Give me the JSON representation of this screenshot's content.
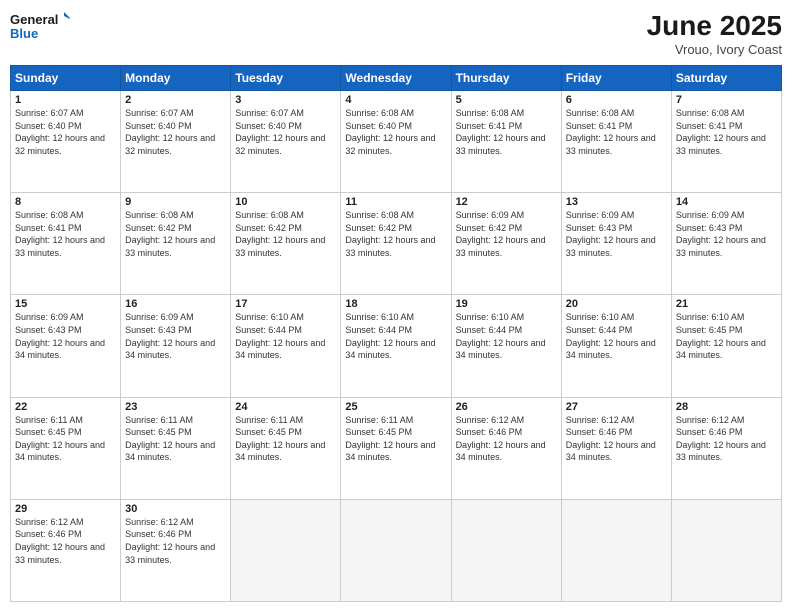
{
  "logo": {
    "line1": "General",
    "line2": "Blue"
  },
  "title": "June 2025",
  "location": "Vrouo, Ivory Coast",
  "days_of_week": [
    "Sunday",
    "Monday",
    "Tuesday",
    "Wednesday",
    "Thursday",
    "Friday",
    "Saturday"
  ],
  "weeks": [
    [
      {
        "day": "1",
        "sunrise": "6:07 AM",
        "sunset": "6:40 PM",
        "daylight": "12 hours and 32 minutes."
      },
      {
        "day": "2",
        "sunrise": "6:07 AM",
        "sunset": "6:40 PM",
        "daylight": "12 hours and 32 minutes."
      },
      {
        "day": "3",
        "sunrise": "6:07 AM",
        "sunset": "6:40 PM",
        "daylight": "12 hours and 32 minutes."
      },
      {
        "day": "4",
        "sunrise": "6:08 AM",
        "sunset": "6:40 PM",
        "daylight": "12 hours and 32 minutes."
      },
      {
        "day": "5",
        "sunrise": "6:08 AM",
        "sunset": "6:41 PM",
        "daylight": "12 hours and 33 minutes."
      },
      {
        "day": "6",
        "sunrise": "6:08 AM",
        "sunset": "6:41 PM",
        "daylight": "12 hours and 33 minutes."
      },
      {
        "day": "7",
        "sunrise": "6:08 AM",
        "sunset": "6:41 PM",
        "daylight": "12 hours and 33 minutes."
      }
    ],
    [
      {
        "day": "8",
        "sunrise": "6:08 AM",
        "sunset": "6:41 PM",
        "daylight": "12 hours and 33 minutes."
      },
      {
        "day": "9",
        "sunrise": "6:08 AM",
        "sunset": "6:42 PM",
        "daylight": "12 hours and 33 minutes."
      },
      {
        "day": "10",
        "sunrise": "6:08 AM",
        "sunset": "6:42 PM",
        "daylight": "12 hours and 33 minutes."
      },
      {
        "day": "11",
        "sunrise": "6:08 AM",
        "sunset": "6:42 PM",
        "daylight": "12 hours and 33 minutes."
      },
      {
        "day": "12",
        "sunrise": "6:09 AM",
        "sunset": "6:42 PM",
        "daylight": "12 hours and 33 minutes."
      },
      {
        "day": "13",
        "sunrise": "6:09 AM",
        "sunset": "6:43 PM",
        "daylight": "12 hours and 33 minutes."
      },
      {
        "day": "14",
        "sunrise": "6:09 AM",
        "sunset": "6:43 PM",
        "daylight": "12 hours and 33 minutes."
      }
    ],
    [
      {
        "day": "15",
        "sunrise": "6:09 AM",
        "sunset": "6:43 PM",
        "daylight": "12 hours and 34 minutes."
      },
      {
        "day": "16",
        "sunrise": "6:09 AM",
        "sunset": "6:43 PM",
        "daylight": "12 hours and 34 minutes."
      },
      {
        "day": "17",
        "sunrise": "6:10 AM",
        "sunset": "6:44 PM",
        "daylight": "12 hours and 34 minutes."
      },
      {
        "day": "18",
        "sunrise": "6:10 AM",
        "sunset": "6:44 PM",
        "daylight": "12 hours and 34 minutes."
      },
      {
        "day": "19",
        "sunrise": "6:10 AM",
        "sunset": "6:44 PM",
        "daylight": "12 hours and 34 minutes."
      },
      {
        "day": "20",
        "sunrise": "6:10 AM",
        "sunset": "6:44 PM",
        "daylight": "12 hours and 34 minutes."
      },
      {
        "day": "21",
        "sunrise": "6:10 AM",
        "sunset": "6:45 PM",
        "daylight": "12 hours and 34 minutes."
      }
    ],
    [
      {
        "day": "22",
        "sunrise": "6:11 AM",
        "sunset": "6:45 PM",
        "daylight": "12 hours and 34 minutes."
      },
      {
        "day": "23",
        "sunrise": "6:11 AM",
        "sunset": "6:45 PM",
        "daylight": "12 hours and 34 minutes."
      },
      {
        "day": "24",
        "sunrise": "6:11 AM",
        "sunset": "6:45 PM",
        "daylight": "12 hours and 34 minutes."
      },
      {
        "day": "25",
        "sunrise": "6:11 AM",
        "sunset": "6:45 PM",
        "daylight": "12 hours and 34 minutes."
      },
      {
        "day": "26",
        "sunrise": "6:12 AM",
        "sunset": "6:46 PM",
        "daylight": "12 hours and 34 minutes."
      },
      {
        "day": "27",
        "sunrise": "6:12 AM",
        "sunset": "6:46 PM",
        "daylight": "12 hours and 34 minutes."
      },
      {
        "day": "28",
        "sunrise": "6:12 AM",
        "sunset": "6:46 PM",
        "daylight": "12 hours and 33 minutes."
      }
    ],
    [
      {
        "day": "29",
        "sunrise": "6:12 AM",
        "sunset": "6:46 PM",
        "daylight": "12 hours and 33 minutes."
      },
      {
        "day": "30",
        "sunrise": "6:12 AM",
        "sunset": "6:46 PM",
        "daylight": "12 hours and 33 minutes."
      },
      null,
      null,
      null,
      null,
      null
    ]
  ]
}
